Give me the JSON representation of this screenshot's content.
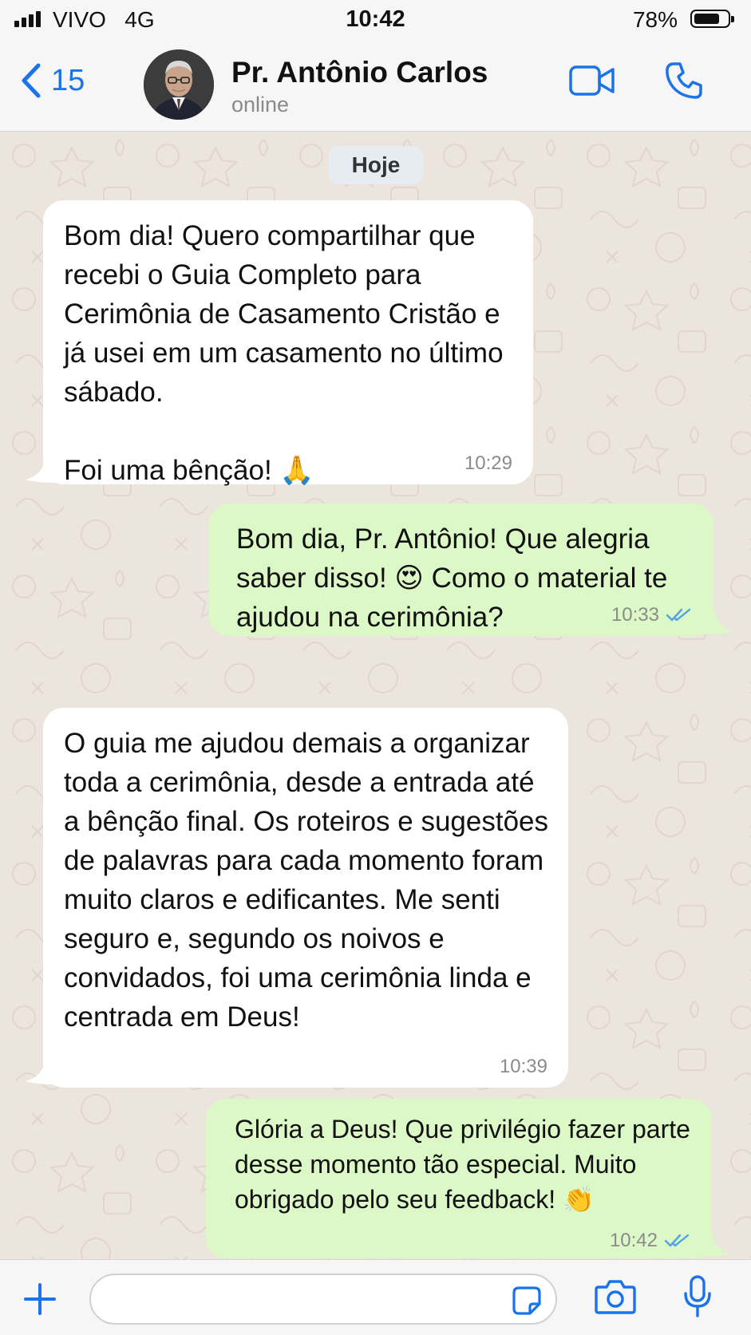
{
  "status_bar": {
    "carrier": "VIVO",
    "network": "4G",
    "time": "10:42",
    "battery_percent": "78%",
    "battery_level": 0.78
  },
  "header": {
    "back_count": "15",
    "contact_name": "Pr. Antônio Carlos",
    "contact_status": "online"
  },
  "chat": {
    "date_chip": "Hoje",
    "messages": [
      {
        "direction": "incoming",
        "text": "Bom dia! Quero compartilhar que recebi o Guia Completo para Cerimônia de Casamento Cristão e já usei em um casamento no último sábado.\n\nFoi uma bênção! 🙏",
        "time": "10:29"
      },
      {
        "direction": "outgoing",
        "text": "Bom dia, Pr. Antônio! Que alegria saber disso! 😍 Como o material te ajudou na cerimônia?",
        "time": "10:33",
        "read": true
      },
      {
        "direction": "incoming",
        "text": "O guia me ajudou demais a organizar toda a cerimônia, desde a entrada até a bênção final. Os roteiros e sugestões de palavras para cada momento foram muito claros e edificantes. Me senti seguro e, segundo os noivos e convidados, foi uma cerimônia linda e centrada em Deus!",
        "time": "10:39"
      },
      {
        "direction": "outgoing",
        "text": "Glória a Deus! Que privilégio fazer parte desse momento tão especial. Muito obrigado pelo seu feedback! 👏",
        "time": "10:42",
        "read": true
      }
    ]
  },
  "input": {
    "placeholder": ""
  },
  "colors": {
    "accent": "#1a73e8",
    "outgoing_bubble": "#dcf8c6",
    "incoming_bubble": "#ffffff",
    "chat_background": "#ece5dd",
    "read_ticks": "#4fa3e0"
  }
}
